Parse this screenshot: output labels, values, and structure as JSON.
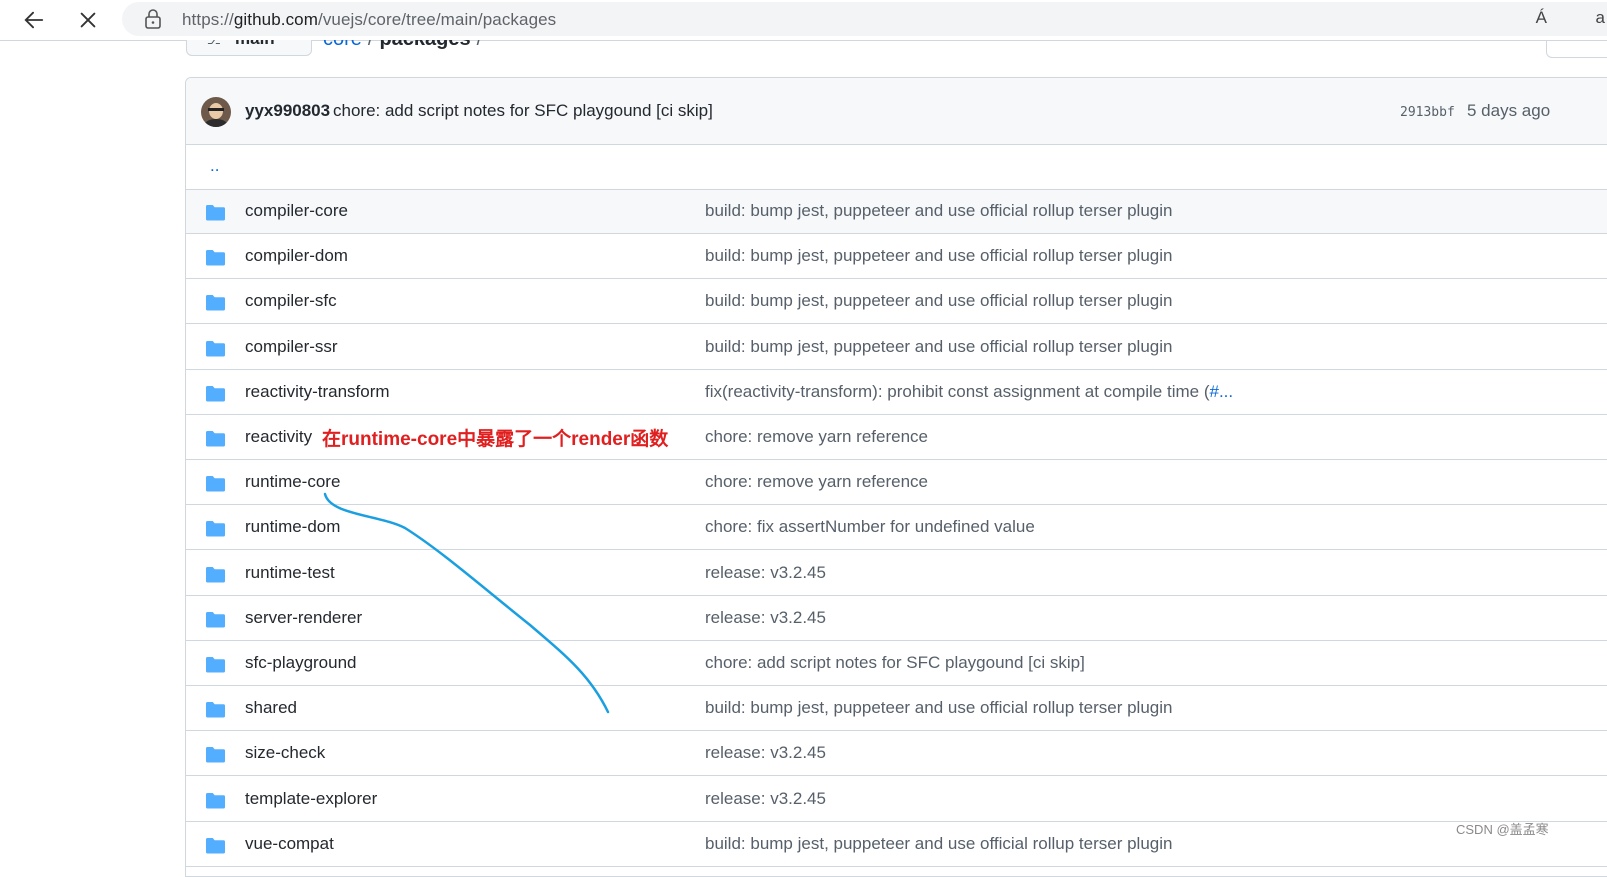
{
  "browser": {
    "url_scheme": "https://",
    "url_host": "github.com",
    "url_path": "/vuejs/core/tree/main/packages",
    "read_aloud_label": "Á",
    "edge_label": "a"
  },
  "breadcrumb": {
    "branch": "main",
    "repo_link": "core",
    "separator": "/",
    "current": "packages",
    "trailing": "/"
  },
  "commit": {
    "author": "yyx990803",
    "message": "chore: add script notes for SFC playgound [ci skip]",
    "sha": "2913bbf",
    "age": "5 days ago"
  },
  "parent_dir": "..",
  "files": [
    {
      "name": "compiler-core",
      "message": "build: bump jest, puppeteer and use official rollup terser plugin"
    },
    {
      "name": "compiler-dom",
      "message": "build: bump jest, puppeteer and use official rollup terser plugin"
    },
    {
      "name": "compiler-sfc",
      "message": "build: bump jest, puppeteer and use official rollup terser plugin"
    },
    {
      "name": "compiler-ssr",
      "message": "build: bump jest, puppeteer and use official rollup terser plugin"
    },
    {
      "name": "reactivity-transform",
      "message": "fix(reactivity-transform): prohibit const assignment at compile time (",
      "issue": "#..."
    },
    {
      "name": "reactivity",
      "message": "chore: remove yarn reference"
    },
    {
      "name": "runtime-core",
      "message": "chore: remove yarn reference"
    },
    {
      "name": "runtime-dom",
      "message": "chore: fix assertNumber for undefined value"
    },
    {
      "name": "runtime-test",
      "message": "release: v3.2.45"
    },
    {
      "name": "server-renderer",
      "message": "release: v3.2.45"
    },
    {
      "name": "sfc-playground",
      "message": "chore: add script notes for SFC playgound [ci skip]"
    },
    {
      "name": "shared",
      "message": "build: bump jest, puppeteer and use official rollup terser plugin"
    },
    {
      "name": "size-check",
      "message": "release: v3.2.45"
    },
    {
      "name": "template-explorer",
      "message": "release: v3.2.45"
    },
    {
      "name": "vue-compat",
      "message": "build: bump jest, puppeteer and use official rollup terser plugin"
    }
  ],
  "annotation": {
    "text": "在runtime-core中暴露了一个render函数",
    "color": "#e02020",
    "arrow_color": "#1a9fe0"
  },
  "watermark": "CSDN @盖孟寒",
  "colors": {
    "folder": "#54aeff",
    "link": "#0969da",
    "border": "#d0d7de"
  },
  "icons": [
    "back-arrow-icon",
    "close-icon",
    "lock-icon",
    "git-branch-icon",
    "folder-icon",
    "clock-icon"
  ]
}
